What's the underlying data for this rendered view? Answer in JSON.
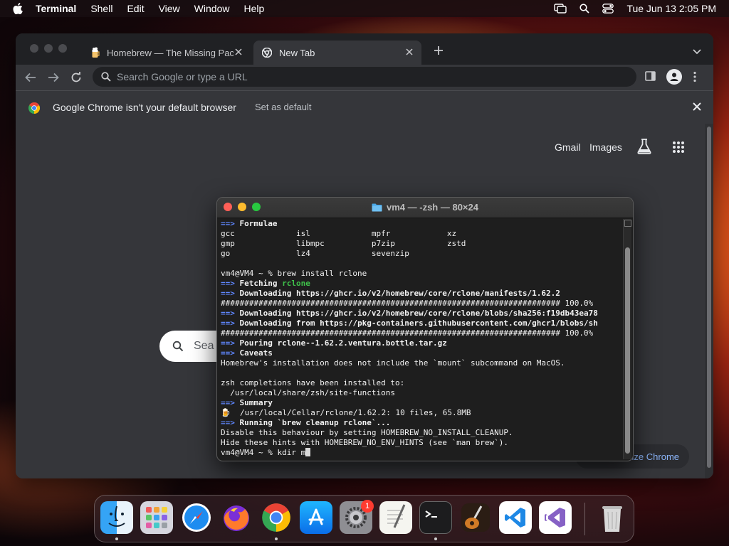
{
  "menubar": {
    "app_name": "Terminal",
    "items": [
      "Shell",
      "Edit",
      "View",
      "Window",
      "Help"
    ],
    "datetime": "Tue Jun 13  2:05 PM"
  },
  "chrome": {
    "tabs": [
      {
        "title": "Homebrew — The Missing Pack",
        "icon": "homebrew-icon"
      },
      {
        "title": "New Tab",
        "icon": "chrome-icon"
      }
    ],
    "omnibox_placeholder": "Search Google or type a URL",
    "infobar": {
      "message": "Google Chrome isn't your default browser",
      "action": "Set as default"
    },
    "content": {
      "links": [
        "Gmail",
        "Images"
      ],
      "search_text": "Sea",
      "customize_label": "ize Chrome"
    }
  },
  "terminal": {
    "title": "vm4 — -zsh — 80×24",
    "lines": [
      [
        {
          "t": "==> ",
          "c": "t-blue"
        },
        {
          "t": "Formulae",
          "c": "t-bold"
        }
      ],
      [
        {
          "t": "gcc             isl             mpfr            xz"
        }
      ],
      [
        {
          "t": "gmp             libmpc          p7zip           zstd"
        }
      ],
      [
        {
          "t": "go              lz4             sevenzip"
        }
      ],
      [
        {
          "t": ""
        }
      ],
      [
        {
          "t": "vm4@VM4 ~ % brew install rclone"
        }
      ],
      [
        {
          "t": "==> ",
          "c": "t-blue"
        },
        {
          "t": "Fetching ",
          "c": "t-bold"
        },
        {
          "t": "rclone",
          "c": "t-green"
        }
      ],
      [
        {
          "t": "==> ",
          "c": "t-blue"
        },
        {
          "t": "Downloading https://ghcr.io/v2/homebrew/core/rclone/manifests/1.62.2",
          "c": "t-bold"
        }
      ],
      [
        {
          "t": "######################################################################## 100.0%"
        }
      ],
      [
        {
          "t": "==> ",
          "c": "t-blue"
        },
        {
          "t": "Downloading https://ghcr.io/v2/homebrew/core/rclone/blobs/sha256:f19db43ea78",
          "c": "t-bold"
        }
      ],
      [
        {
          "t": "==> ",
          "c": "t-blue"
        },
        {
          "t": "Downloading from https://pkg-containers.githubusercontent.com/ghcr1/blobs/sh",
          "c": "t-bold"
        }
      ],
      [
        {
          "t": "######################################################################## 100.0%"
        }
      ],
      [
        {
          "t": "==> ",
          "c": "t-blue"
        },
        {
          "t": "Pouring rclone--1.62.2.ventura.bottle.tar.gz",
          "c": "t-bold"
        }
      ],
      [
        {
          "t": "==> ",
          "c": "t-blue"
        },
        {
          "t": "Caveats",
          "c": "t-bold"
        }
      ],
      [
        {
          "t": "Homebrew's installation does not include the `mount` subcommand on MacOS."
        }
      ],
      [
        {
          "t": ""
        }
      ],
      [
        {
          "t": "zsh completions have been installed to:"
        }
      ],
      [
        {
          "t": "  /usr/local/share/zsh/site-functions"
        }
      ],
      [
        {
          "t": "==> ",
          "c": "t-blue"
        },
        {
          "t": "Summary",
          "c": "t-bold"
        }
      ],
      [
        {
          "t": "🍺  /usr/local/Cellar/rclone/1.62.2: 10 files, 65.8MB"
        }
      ],
      [
        {
          "t": "==> ",
          "c": "t-blue"
        },
        {
          "t": "Running `brew cleanup rclone`...",
          "c": "t-bold"
        }
      ],
      [
        {
          "t": "Disable this behaviour by setting HOMEBREW_NO_INSTALL_CLEANUP."
        }
      ],
      [
        {
          "t": "Hide these hints with HOMEBREW_NO_ENV_HINTS (see `man brew`)."
        }
      ],
      [
        {
          "t": "vm4@VM4 ~ % kdir m"
        }
      ]
    ]
  },
  "dock": {
    "items": [
      "finder",
      "launchpad",
      "safari",
      "firefox",
      "chrome",
      "app-store",
      "system-settings",
      "textedit",
      "terminal",
      "garageband",
      "vscode",
      "visual-studio",
      "trash"
    ],
    "settings_badge": "1"
  }
}
